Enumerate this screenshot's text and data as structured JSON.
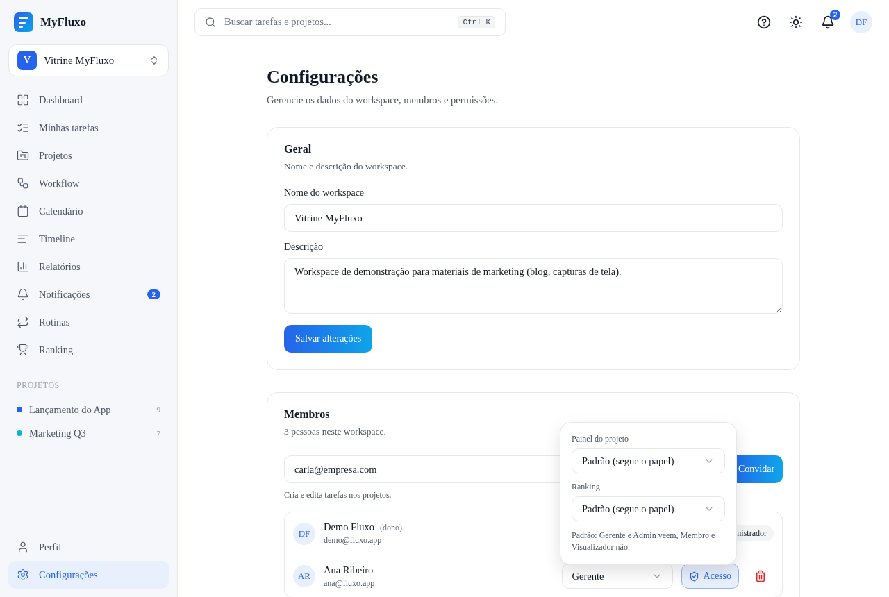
{
  "brand": {
    "name": "MyFluxo"
  },
  "workspace": {
    "initial": "V",
    "name": "Vitrine MyFluxo"
  },
  "nav": [
    {
      "label": "Dashboard",
      "selected": false
    },
    {
      "label": "Minhas tarefas",
      "selected": false
    },
    {
      "label": "Projetos",
      "selected": false
    },
    {
      "label": "Workflow",
      "selected": false
    },
    {
      "label": "Calendário",
      "selected": false
    },
    {
      "label": "Timeline",
      "selected": false
    },
    {
      "label": "Relatórios",
      "selected": false
    },
    {
      "label": "Notificações",
      "selected": false,
      "badge": "2"
    },
    {
      "label": "Rotinas",
      "selected": false
    },
    {
      "label": "Ranking",
      "selected": false
    }
  ],
  "projects": {
    "heading": "PROJETOS",
    "items": [
      {
        "name": "Lançamento do App",
        "count": "9",
        "color": "#2563eb"
      },
      {
        "name": "Marketing Q3",
        "count": "7",
        "color": "#06b6d4"
      }
    ]
  },
  "bottom_nav": [
    {
      "label": "Perfil",
      "selected": false
    },
    {
      "label": "Configurações",
      "selected": true
    }
  ],
  "topbar": {
    "search_placeholder": "Buscar tarefas e projetos...",
    "shortcut": "Ctrl K",
    "notification_count": "2",
    "avatar": "DF"
  },
  "page": {
    "title": "Configurações",
    "subtitle": "Gerencie os dados do workspace, membros e permissões."
  },
  "general": {
    "title": "Geral",
    "subtitle": "Nome e descrição do workspace.",
    "name_label": "Nome do workspace",
    "name_value": "Vitrine MyFluxo",
    "desc_label": "Descrição",
    "desc_value": "Workspace de demonstração para materiais de marketing (blog, capturas de tela).",
    "save": "Salvar alterações"
  },
  "members": {
    "title": "Membros",
    "subtitle": "3 pessoas neste workspace.",
    "invite_value": "carla@empresa.com",
    "invite_button": "Convidar",
    "hint": "Cria e edita tarefas nos projetos.",
    "rows": [
      {
        "kind": "owner",
        "initials": "DF",
        "name": "Demo Fluxo",
        "tag": "(dono)",
        "email": "demo@fluxo.app",
        "role": "nistrador"
      },
      {
        "kind": "member",
        "initials": "AR",
        "name": "Ana Ribeiro",
        "email": "ana@fluxo.app",
        "role": "Gerente",
        "access": "Acesso"
      }
    ]
  },
  "popover": {
    "fields": [
      {
        "label": "Painel do projeto",
        "value": "Padrão (segue o papel)"
      },
      {
        "label": "Ranking",
        "value": "Padrão (segue o papel)"
      }
    ],
    "note": "Padrão: Gerente e Admin veem, Membro e Visualizador não."
  }
}
